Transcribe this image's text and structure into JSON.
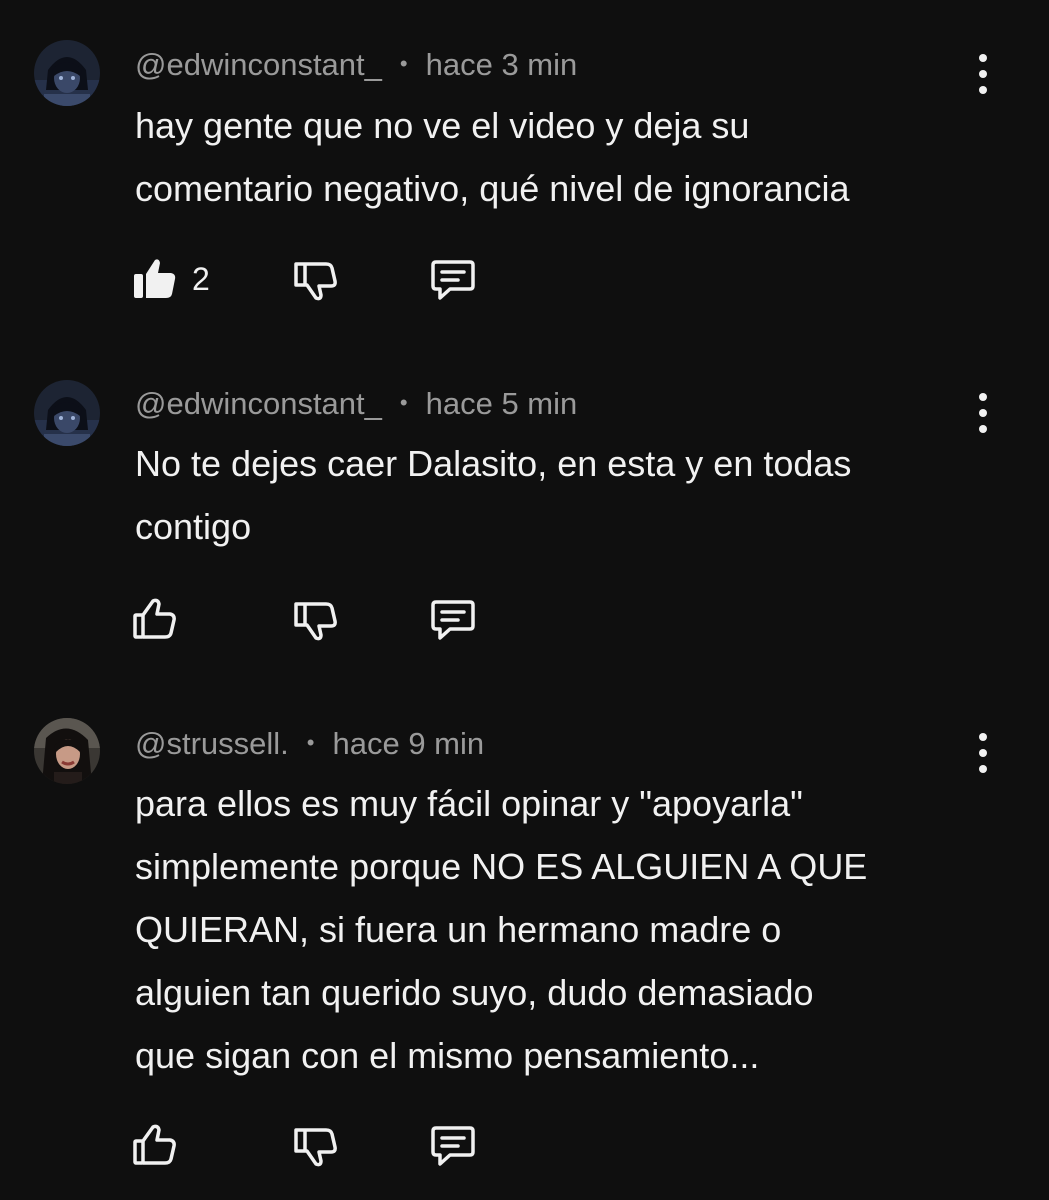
{
  "comments": [
    {
      "handle": "@edwinconstant_",
      "separator": "•",
      "time": "hace 3 min",
      "text": "hay gente que no ve el video y deja su\ncomentario negativo, qué nivel de ignorancia",
      "likes": "2",
      "liked": true,
      "avatar_icon": "anime-character-avatar"
    },
    {
      "handle": "@edwinconstant_",
      "separator": "•",
      "time": "hace 5 min",
      "text": "No te dejes caer Dalasito, en esta y en todas\ncontigo",
      "likes": "",
      "liked": false,
      "avatar_icon": "anime-character-avatar"
    },
    {
      "handle": "@strussell.",
      "separator": "•",
      "time": "hace 9 min",
      "text": "para ellos es muy fácil opinar y \"apoyarla\"\nsimplemente porque NO ES ALGUIEN A QUE\nQUIERAN, si fuera un hermano madre o\nalguien tan querido suyo, dudo demasiado\nque sigan con el mismo pensamiento...",
      "likes": "",
      "liked": false,
      "avatar_icon": "person-photo-avatar"
    }
  ],
  "icons": {
    "like": "thumbs-up-icon",
    "dislike": "thumbs-down-icon",
    "reply": "reply-comment-icon",
    "menu": "more-vertical-icon"
  },
  "colors": {
    "background": "#0f0f0f",
    "text": "#f1f1f1",
    "meta": "#9a9a9a"
  }
}
